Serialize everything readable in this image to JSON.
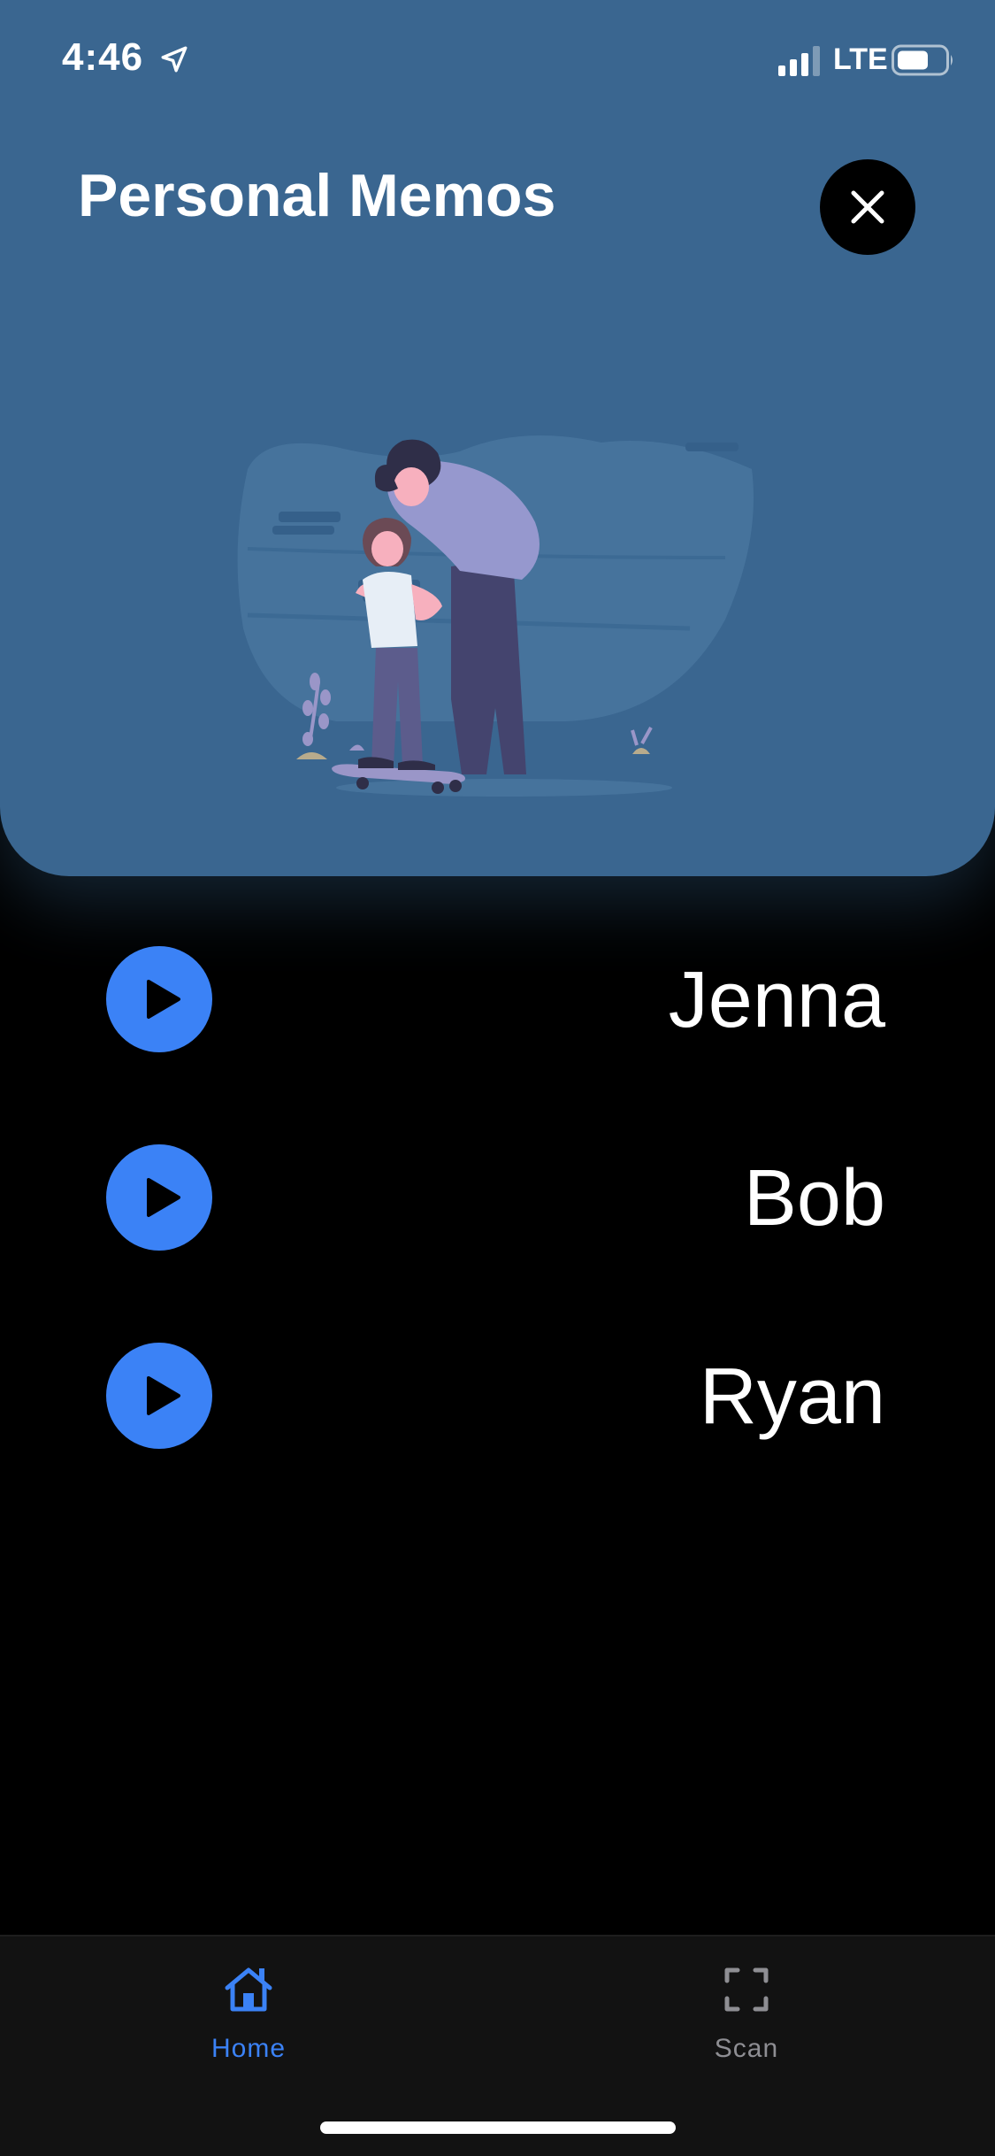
{
  "status_bar": {
    "time": "4:46",
    "network": "LTE"
  },
  "header": {
    "title": "Personal Memos",
    "close_icon": "close-icon",
    "background_color": "#3a6690"
  },
  "illustration": {
    "description_icon": "parent-child-skateboard-illustration"
  },
  "memos": [
    {
      "name": "Jenna",
      "icon": "play-icon"
    },
    {
      "name": "Bob",
      "icon": "play-icon"
    },
    {
      "name": "Ryan",
      "icon": "play-icon"
    }
  ],
  "tab_bar": {
    "tabs": [
      {
        "label": "Home",
        "icon": "home-icon",
        "active": true
      },
      {
        "label": "Scan",
        "icon": "scan-icon",
        "active": false
      }
    ],
    "active_color": "#3b82f6",
    "inactive_color": "#8e8e93"
  },
  "colors": {
    "accent": "#3b82f6",
    "background": "#000000"
  }
}
